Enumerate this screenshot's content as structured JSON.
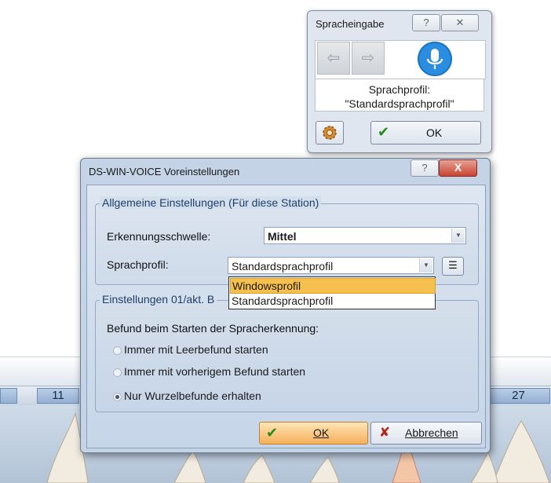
{
  "voice_widget": {
    "title": "Spracheingabe",
    "help_icon": "help-icon",
    "close_icon": "close-icon",
    "back_icon": "arrow-left-icon",
    "forward_icon": "arrow-right-icon",
    "mic_icon": "microphone-icon",
    "profile_line1": "Sprachprofil:",
    "profile_line2": "\"Standardsprachprofil\"",
    "settings_icon": "gear-icon",
    "ok_label": "OK"
  },
  "dialog": {
    "title": "DS-WIN-VOICE Voreinstellungen",
    "close_label": "X",
    "general_group": {
      "legend": "Allgemeine Einstellungen (Für diese Station)",
      "threshold_label": "Erkennungsschwelle:",
      "threshold_value": "Mittel",
      "profile_label": "Sprachprofil:",
      "profile_value": "Standardsprachprofil",
      "profile_options": [
        "Windowsprofil",
        "Standardsprachprofil"
      ],
      "highlighted_option": "Windowsprofil"
    },
    "station_group": {
      "legend": "Einstellungen 01/akt. B",
      "prompt": "Befund beim Starten der Spracherkennung:",
      "options": [
        {
          "label": "Immer mit Leerbefund starten",
          "selected": false
        },
        {
          "label": "Immer mit vorherigem Befund starten",
          "selected": false
        },
        {
          "label": "Nur Wurzelbefunde erhalten",
          "selected": true
        }
      ]
    },
    "ok_label": "OK",
    "cancel_label": "Abbrechen",
    "colors": {
      "accent": "#f6b05a",
      "highlight": "#f6c04e",
      "mic": "#2a8ddf",
      "close": "#c74532"
    }
  },
  "background": {
    "tooth_left": "11",
    "tooth_right": "27"
  }
}
